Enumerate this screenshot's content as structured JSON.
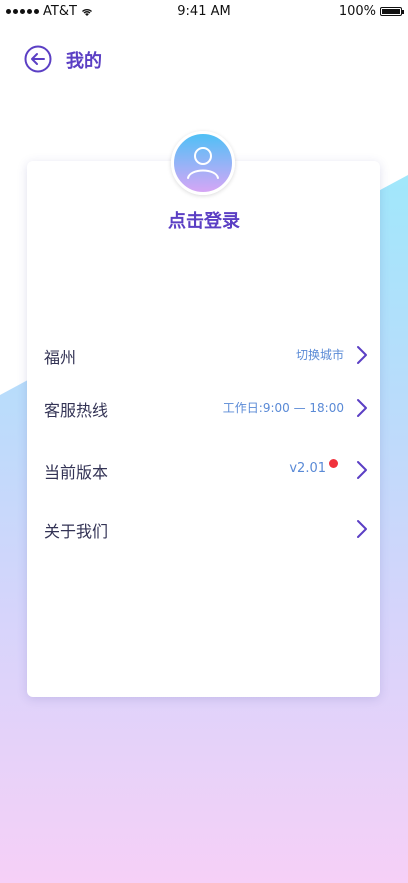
{
  "status_bar": {
    "carrier": "AT&T",
    "time": "9:41 AM",
    "battery": "100%"
  },
  "nav": {
    "title": "我的",
    "back_icon": "back-arrow-icon"
  },
  "profile": {
    "login_label": "点击登录",
    "avatar_icon": "user-avatar-icon"
  },
  "menu": {
    "items": [
      {
        "label": "福州",
        "value": "切换城市"
      },
      {
        "label": "客服热线",
        "value": "工作日:9:00 — 18:00"
      },
      {
        "label": "当前版本",
        "value": "v2.01"
      },
      {
        "label": "关于我们",
        "value": ""
      }
    ]
  },
  "colors": {
    "accent": "#5b3fc4",
    "value_text": "#5a8ad6",
    "badge": "#f0323c"
  }
}
